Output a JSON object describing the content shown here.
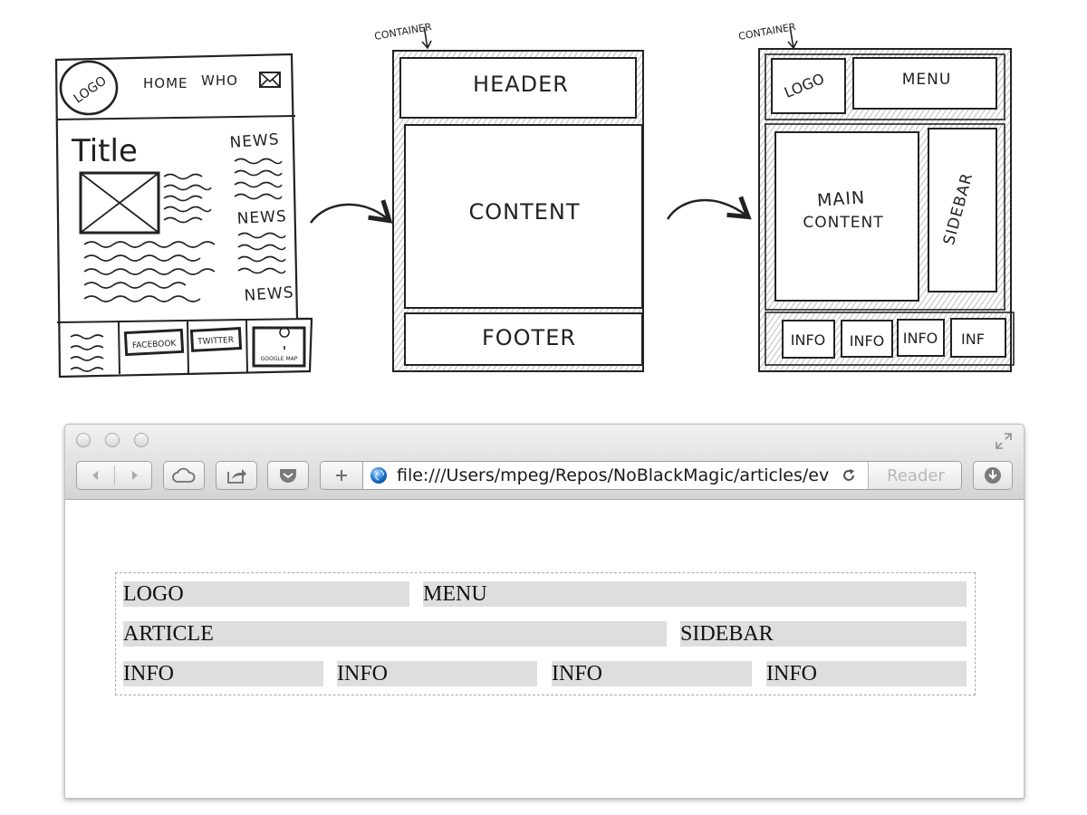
{
  "sketches": {
    "wireframe": {
      "logo": "LOGO",
      "nav": [
        "HOME",
        "WHO"
      ],
      "title": "Title",
      "news": [
        "NEWS",
        "NEWS",
        "NEWS"
      ],
      "footer_buttons": [
        "FACEBOOK",
        "TWITTER",
        "GOOGLE MAP"
      ]
    },
    "container_layout": {
      "caption": "CONTAINER",
      "header": "HEADER",
      "content": "CONTENT",
      "footer": "FOOTER"
    },
    "detailed_layout": {
      "caption": "CONTAINER",
      "logo": "LOGO",
      "menu": "MENU",
      "main_content_line1": "MAIN",
      "main_content_line2": "CONTENT",
      "sidebar": "SIDEBAR",
      "info": [
        "INFO",
        "INFO",
        "INFO",
        "INF"
      ]
    }
  },
  "browser": {
    "url": "file:///Users/mpeg/Repos/NoBlackMagic/articles/ev",
    "reader_label": "Reader",
    "icons": {
      "back": "chevron-left-icon",
      "forward": "chevron-right-icon",
      "icloud": "cloud-icon",
      "share": "share-icon",
      "pocket": "pocket-icon",
      "add_bookmark": "plus-icon",
      "site": "globe-icon",
      "reload": "reload-icon",
      "downloads": "download-icon",
      "fullscreen": "fullscreen-icon"
    }
  },
  "page": {
    "row1": [
      "LOGO",
      "MENU"
    ],
    "row2": [
      "ARTICLE",
      "SIDEBAR"
    ],
    "row3": [
      "INFO",
      "INFO",
      "INFO",
      "INFO"
    ]
  },
  "colors": {
    "cell_bg": "#dedede",
    "container_border": "#a9a9a9",
    "sketch_ink": "#222222"
  }
}
